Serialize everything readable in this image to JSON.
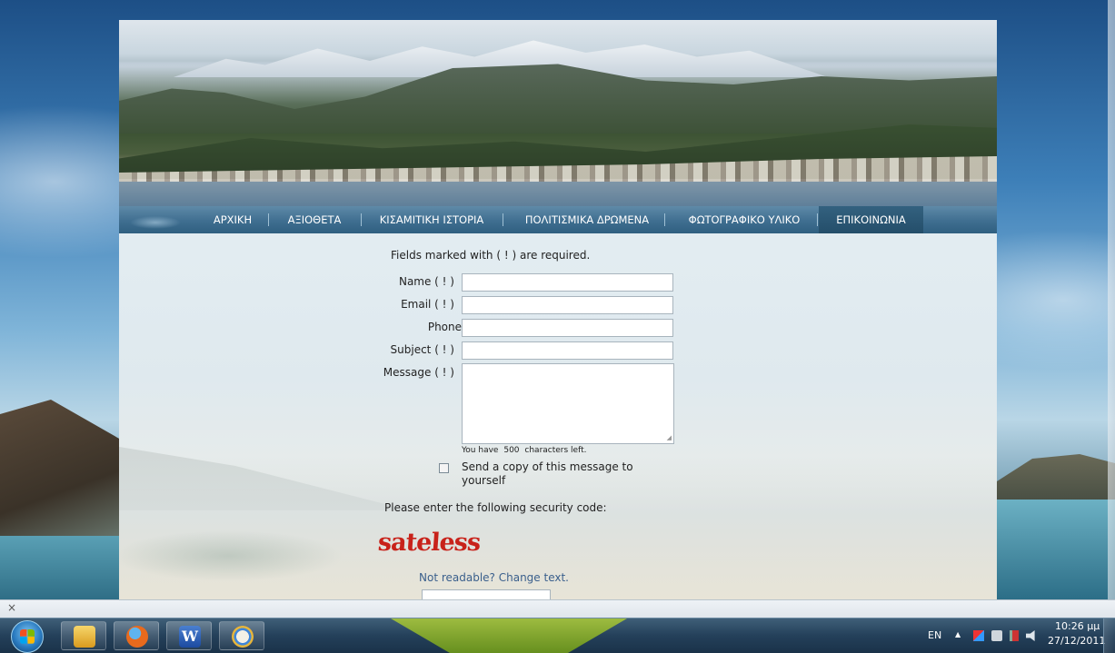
{
  "nav": {
    "items": [
      "ΑΡΧΙΚΗ",
      "ΑΞΙΟΘΕΤΑ",
      "ΚΙΣΑΜΙΤΙΚΗ ΙΣΤΟΡΙΑ",
      "ΠΟΛΙΤΙΣΜΙΚΑ ΔΡΩΜΕΝΑ",
      "ΦΩΤΟΓΡΑΦΙΚΟ ΥΛΙΚΟ",
      "ΕΠΙΚΟΙΝΩΝΙΑ"
    ],
    "active": "ΕΠΙΚΟΙΝΩΝΙΑ"
  },
  "form": {
    "required_note": "Fields marked with ( ! ) are required.",
    "name_label": "Name ( ! )",
    "email_label": "Email ( ! )",
    "phone_label": "Phone",
    "subject_label": "Subject ( ! )",
    "message_label": "Message ( ! )",
    "chars_prefix": "You have",
    "chars_left": "500",
    "chars_suffix": "characters left.",
    "copy_label": "Send a copy of this message to yourself",
    "security_prompt": "Please enter the following security code:",
    "captcha_word": "sateless",
    "change_text": "Not readable? Change text."
  },
  "browser": {
    "close_glyph": "×"
  },
  "taskbar": {
    "language": "EN",
    "time": "10:26 μμ",
    "date": "27/12/2011",
    "tray_up_glyph": "▲",
    "word_icon_letter": "W"
  }
}
